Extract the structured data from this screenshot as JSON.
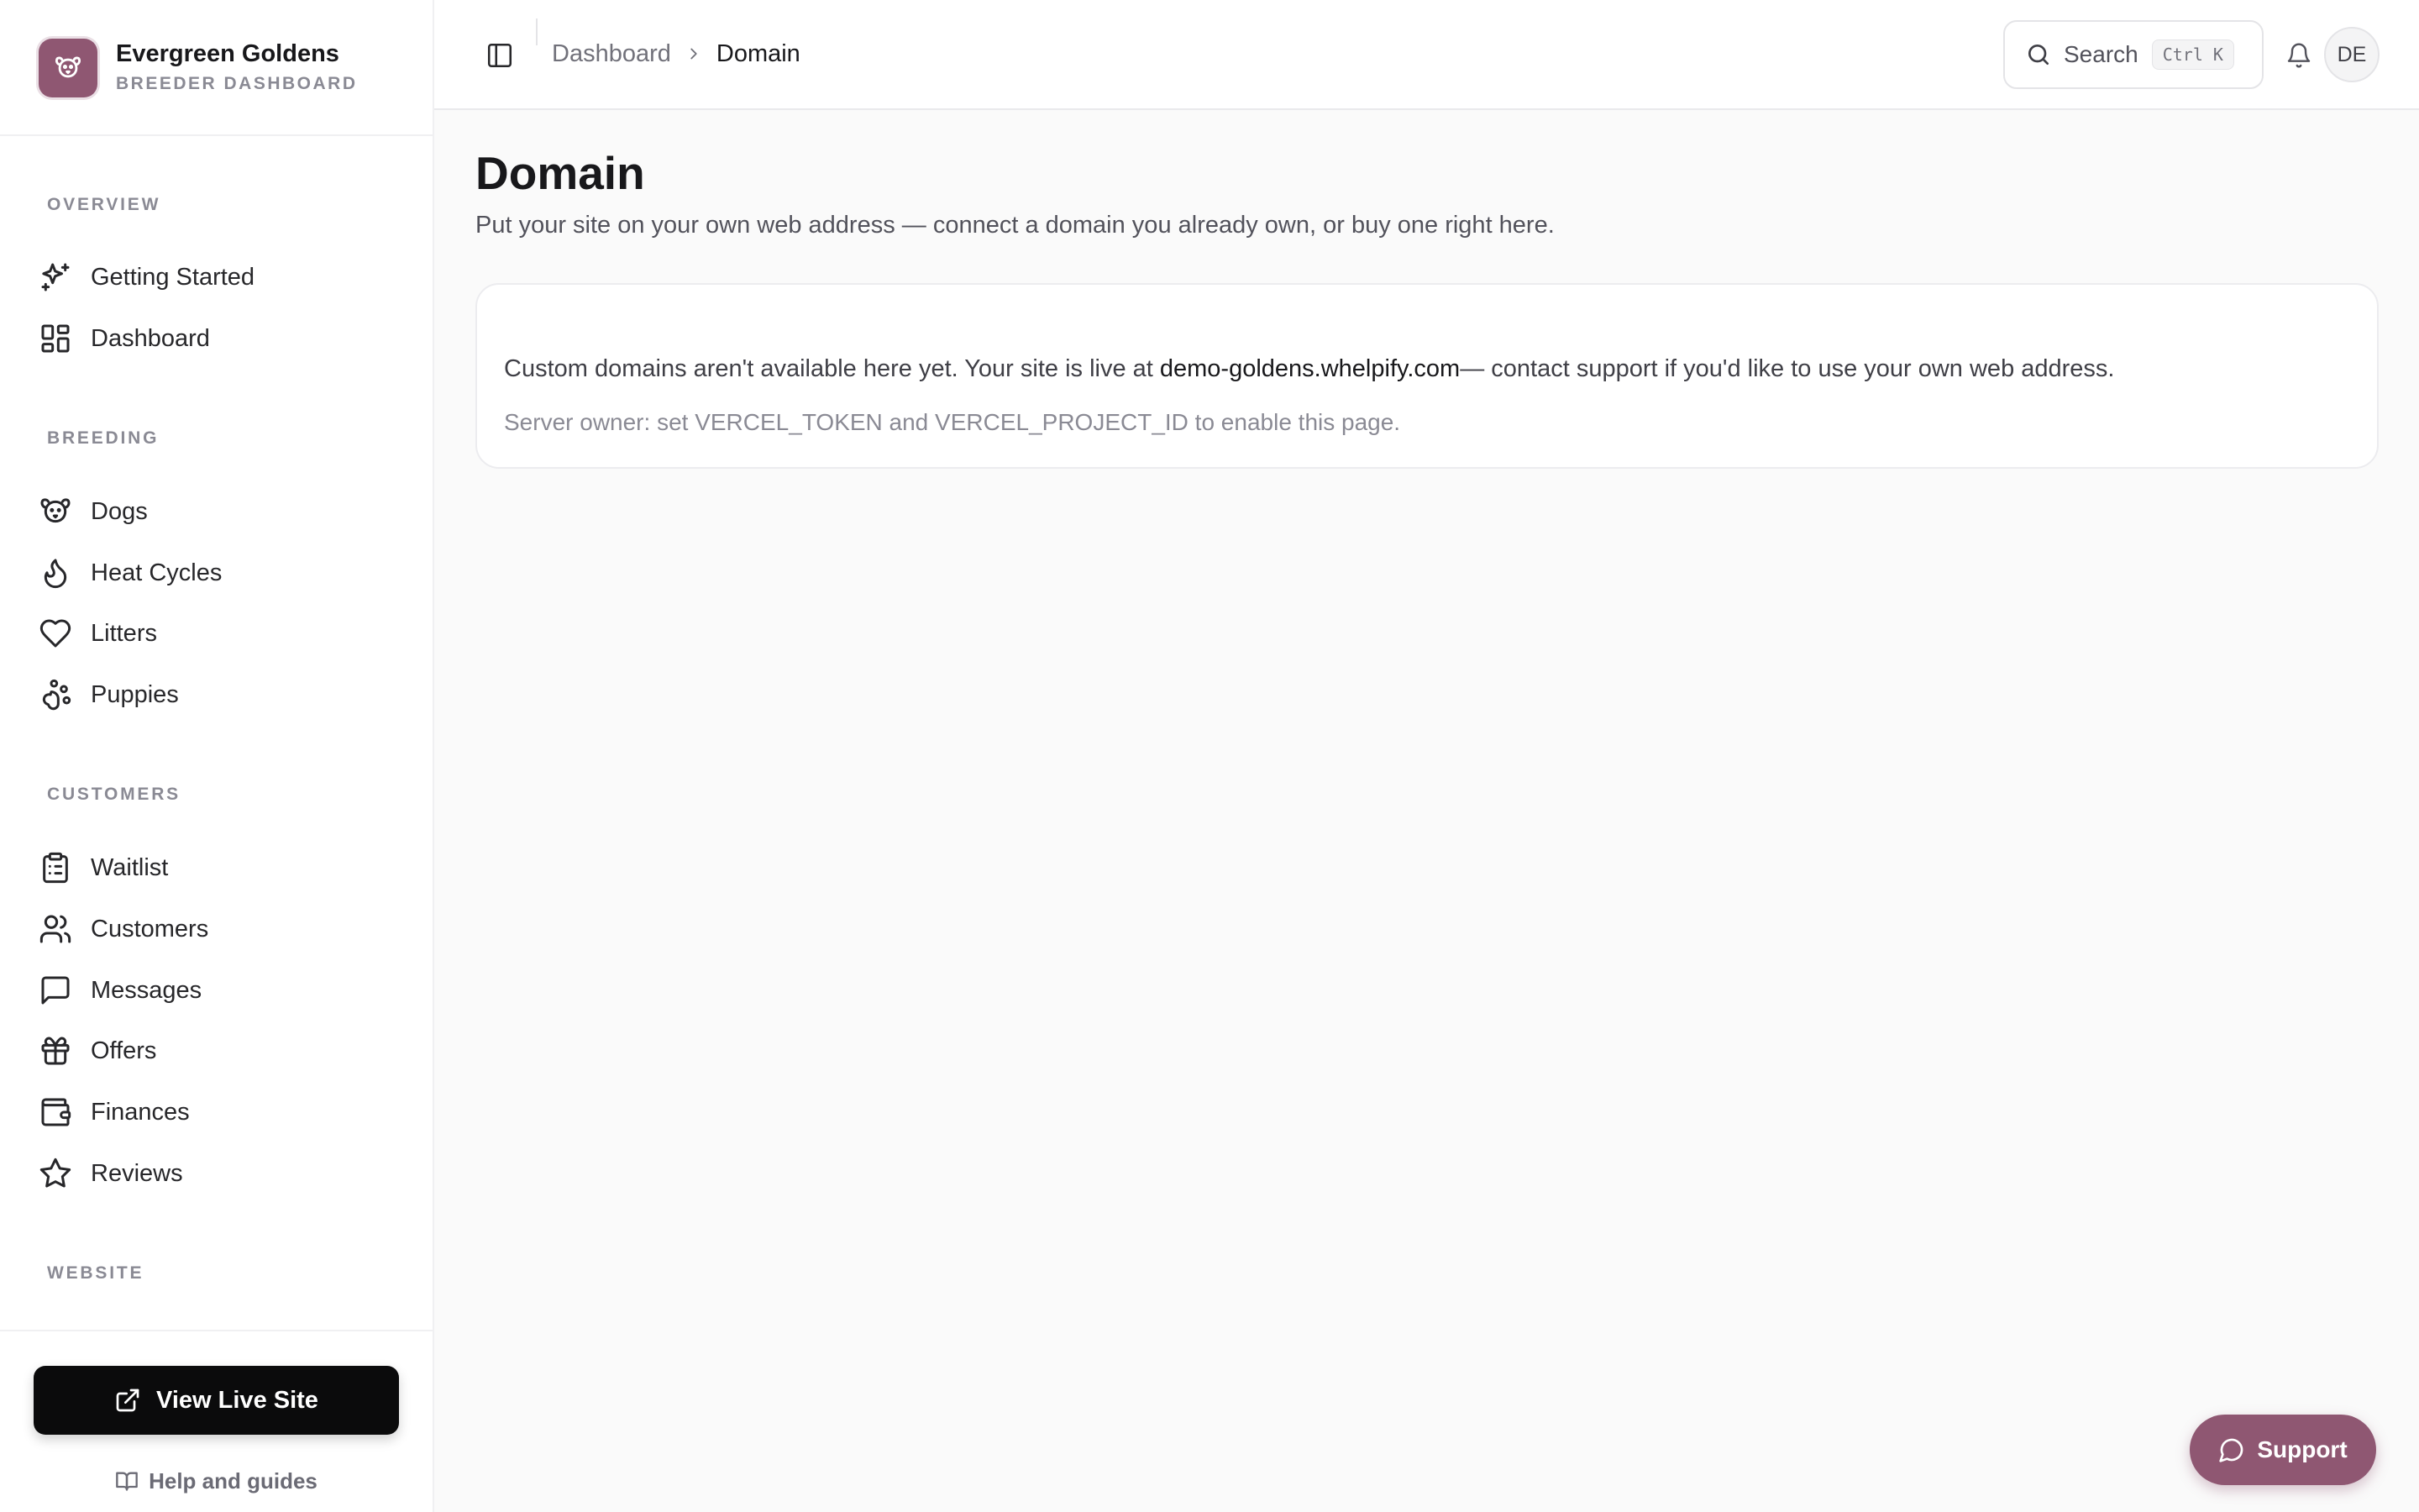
{
  "brand": {
    "name": "Evergreen Goldens",
    "subtitle": "BREEDER DASHBOARD",
    "accent_color": "#8f5772",
    "logo_icon": "dog-face-icon"
  },
  "sidebar": {
    "sections": [
      {
        "label": "OVERVIEW",
        "items": [
          {
            "label": "Getting Started",
            "icon": "sparkles-icon"
          },
          {
            "label": "Dashboard",
            "icon": "layout-grid-icon"
          }
        ]
      },
      {
        "label": "BREEDING",
        "items": [
          {
            "label": "Dogs",
            "icon": "dog-icon"
          },
          {
            "label": "Heat Cycles",
            "icon": "flame-icon"
          },
          {
            "label": "Litters",
            "icon": "heart-icon"
          },
          {
            "label": "Puppies",
            "icon": "paw-icon"
          }
        ]
      },
      {
        "label": "CUSTOMERS",
        "items": [
          {
            "label": "Waitlist",
            "icon": "clipboard-list-icon"
          },
          {
            "label": "Customers",
            "icon": "users-icon"
          },
          {
            "label": "Messages",
            "icon": "message-square-icon"
          },
          {
            "label": "Offers",
            "icon": "gift-icon"
          },
          {
            "label": "Finances",
            "icon": "wallet-icon"
          },
          {
            "label": "Reviews",
            "icon": "star-icon"
          }
        ]
      },
      {
        "label": "WEBSITE",
        "items": []
      }
    ],
    "footer": {
      "live_site_label": "View Live Site",
      "live_site_icon": "external-link-icon",
      "help_label": "Help and guides",
      "help_icon": "book-open-icon"
    }
  },
  "header": {
    "breadcrumb": {
      "parent": "Dashboard",
      "current": "Domain"
    },
    "search": {
      "label": "Search",
      "shortcut": "Ctrl K"
    },
    "avatar_initials": "DE"
  },
  "main": {
    "title": "Domain",
    "description": "Put your site on your own web address — connect a domain you already own, or buy one right here.",
    "notice": {
      "prefix": "Custom domains aren't available here yet. Your site is live at ",
      "domain": "demo-goldens.whelpify.com",
      "suffix": "— contact support if you'd like to use your own web address."
    },
    "owner_note": "Server owner: set VERCEL_TOKEN and VERCEL_PROJECT_ID to enable this page."
  },
  "support": {
    "label": "Support",
    "icon": "message-circle-icon"
  }
}
